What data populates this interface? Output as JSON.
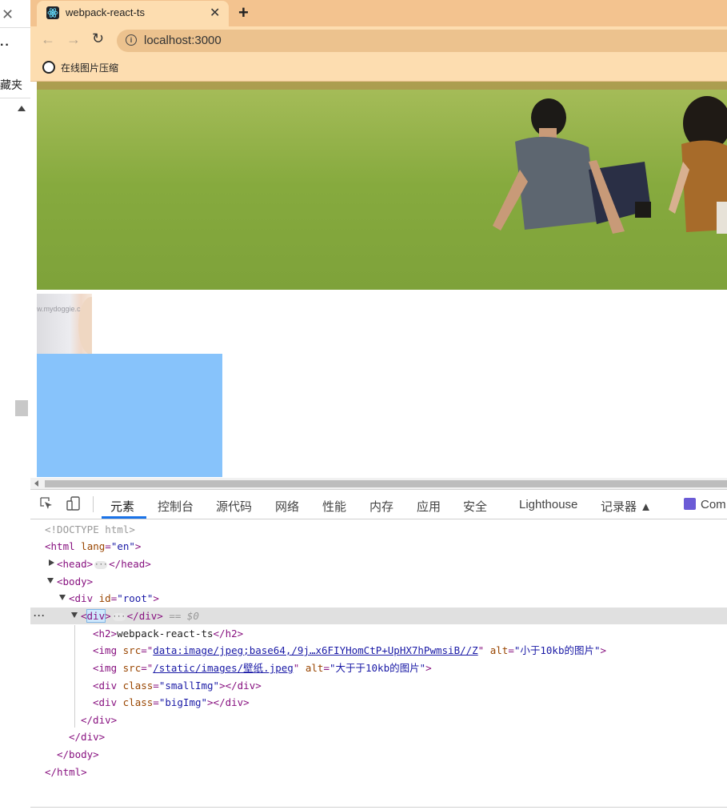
{
  "left_panel": {
    "close_glyph": "✕",
    "dots": "··",
    "text": "藏夹"
  },
  "browser": {
    "tab_title": "webpack-react-ts",
    "tab_close": "✕",
    "new_tab": "+",
    "url": "localhost:3000",
    "bookmark_label": "在线图片压缩"
  },
  "page": {
    "small_img_text": "w.mydoggie.c"
  },
  "devtools": {
    "tabs": [
      {
        "label": "元素",
        "active": true
      },
      {
        "label": "控制台"
      },
      {
        "label": "源代码"
      },
      {
        "label": "网络"
      },
      {
        "label": "性能"
      },
      {
        "label": "内存"
      },
      {
        "label": "应用"
      },
      {
        "label": "安全"
      },
      {
        "label": "Lighthouse"
      },
      {
        "label": "记录器 ▲"
      },
      {
        "label": "Com"
      }
    ],
    "dom": {
      "doctype": "<!DOCTYPE html>",
      "html_open": "<html",
      "lang_attr": "lang",
      "lang_val": "\"en\"",
      "head_open": "<head>",
      "head_close": "</head>",
      "body_open": "<body>",
      "root_open": "<div",
      "id_attr": "id",
      "id_val": "\"root\"",
      "div_open_lt": "<",
      "div_open_name": "div",
      "div_open_gt": ">",
      "div_close": "</div>",
      "selected_marker": "== $0",
      "h2_open": "<h2>",
      "h2_text": "webpack-react-ts",
      "h2_close": "</h2>",
      "img_open": "<img",
      "src_attr": "src",
      "eq_quote": "=\"",
      "quote": "\"",
      "img1_src": "data:image/jpeg;base64,/9j…x6FIYHomCtP+UpHX7hPwmsiB//Z",
      "alt_attr": "alt",
      "img1_alt": "\"小于10kb的图片\"",
      "img2_src": "/static/images/壁纸.jpeg",
      "img2_alt": "\"大于于10kb的图片\"",
      "gt": ">",
      "div_class_open": "<div",
      "class_attr": "class",
      "small_class": "\"smallImg\"",
      "big_class": "\"bigImg\"",
      "div_close_tail": "></div>",
      "inner_div_close": "</div>",
      "root_close": "</div>",
      "body_close": "</body>",
      "html_close": "</html>"
    }
  }
}
